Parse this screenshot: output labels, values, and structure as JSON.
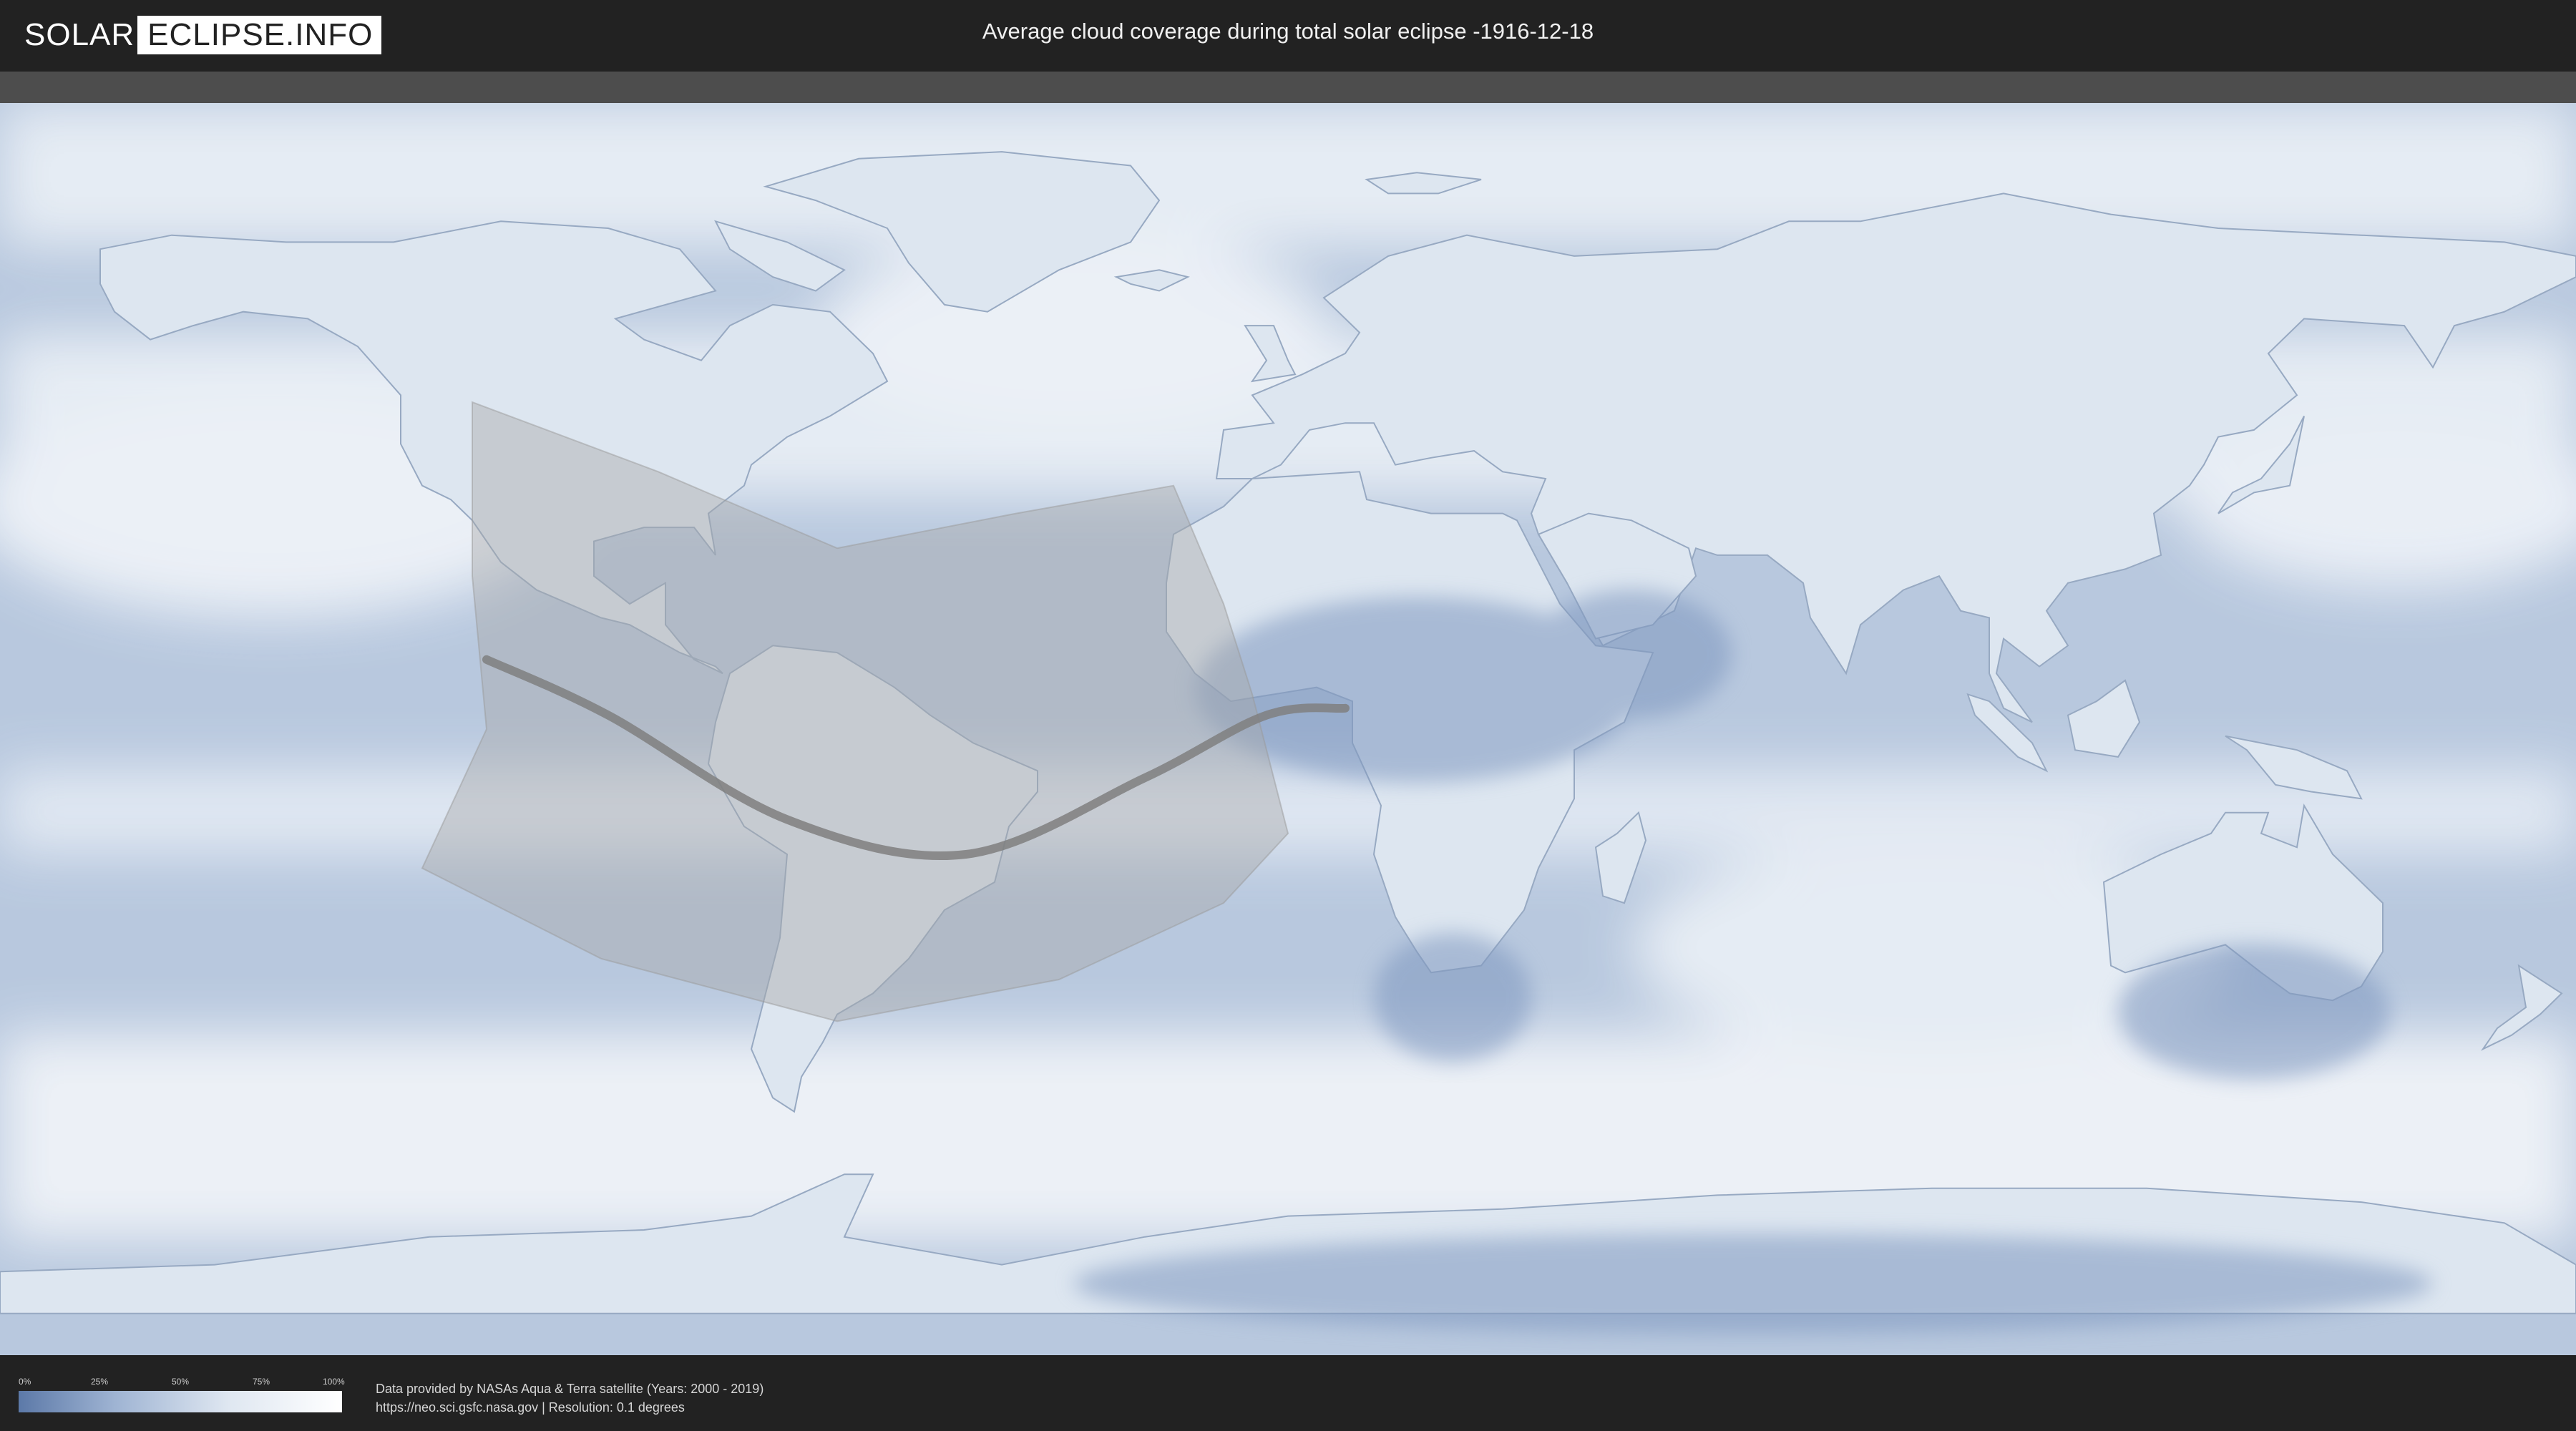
{
  "header": {
    "logo_left": "SOLAR",
    "logo_right": "ECLIPSE.INFO",
    "title": "Average cloud coverage during total solar eclipse -1916-12-18"
  },
  "legend": {
    "ticks": [
      "0%",
      "25%",
      "50%",
      "75%",
      "100%"
    ],
    "colors": {
      "low": "#5c79a8",
      "mid": "#dfe7f1",
      "high": "#ffffff"
    }
  },
  "footer": {
    "credit_line1": "Data provided by NASAs Aqua & Terra satellite (Years: 2000 - 2019)",
    "credit_line2": "https://neo.sci.gsfc.nasa.gov | Resolution: 0.1 degrees"
  },
  "map": {
    "projection": "equirectangular",
    "ocean_color": "#b8c8de",
    "land_color": "#dde6f0",
    "cloud_color": "#f3f6fa",
    "shadow_color": "#a8a8a8",
    "eclipse_path": [
      [
        -112,
        10
      ],
      [
        -95,
        2
      ],
      [
        -70,
        -13
      ],
      [
        -45,
        -18
      ],
      [
        -20,
        -7
      ],
      [
        -3,
        2
      ],
      [
        8,
        3
      ]
    ],
    "shadow_region": [
      [
        -114,
        47
      ],
      [
        -88,
        37
      ],
      [
        -63,
        26
      ],
      [
        -38,
        31
      ],
      [
        -16,
        35
      ],
      [
        -9,
        18
      ],
      [
        -5,
        5
      ],
      [
        0,
        -15
      ],
      [
        -9,
        -25
      ],
      [
        -32,
        -36
      ],
      [
        -63,
        -42
      ],
      [
        -96,
        -33
      ],
      [
        -121,
        -20
      ],
      [
        -112,
        0
      ],
      [
        -114,
        22
      ],
      [
        -114,
        47
      ]
    ]
  }
}
